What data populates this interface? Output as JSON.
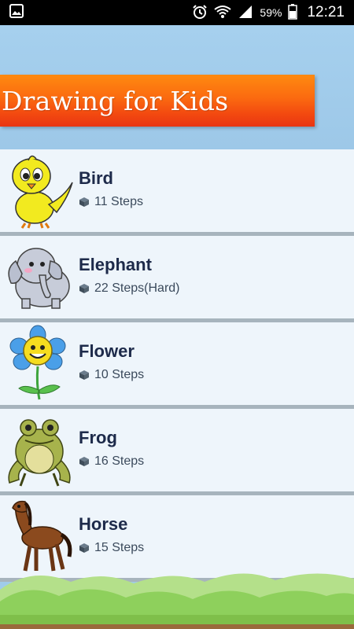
{
  "status_bar": {
    "battery": "59%",
    "time": "12:21",
    "icons": [
      "gallery-icon",
      "alarm-icon",
      "wifi-icon",
      "signal-icon",
      "battery-icon"
    ]
  },
  "header": {
    "title": "Drawing for Kids"
  },
  "items": [
    {
      "name": "Bird",
      "steps": "11 Steps",
      "icon": "bird-icon"
    },
    {
      "name": "Elephant",
      "steps": "22 Steps(Hard)",
      "icon": "elephant-icon"
    },
    {
      "name": "Flower",
      "steps": "10 Steps",
      "icon": "flower-icon"
    },
    {
      "name": "Frog",
      "steps": "16 Steps",
      "icon": "frog-icon"
    },
    {
      "name": "Horse",
      "steps": "15 Steps",
      "icon": "horse-icon"
    }
  ],
  "colors": {
    "banner": "#f34a10",
    "sky": "#9fcbea",
    "item_bg": "#eef5fb",
    "text": "#1d2a4a"
  }
}
